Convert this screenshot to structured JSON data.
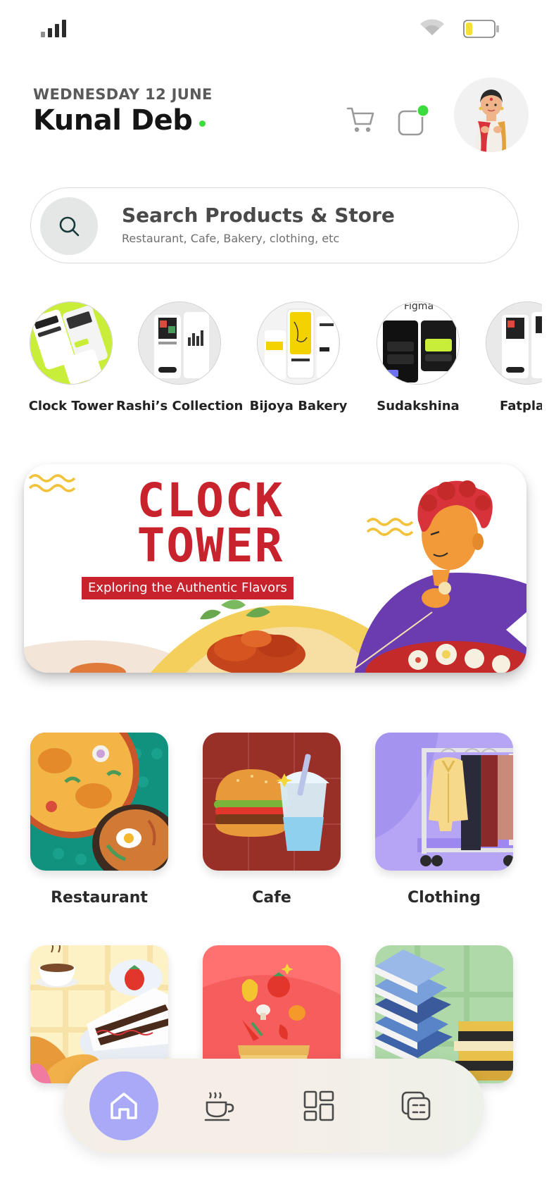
{
  "header": {
    "date": "WEDNESDAY 12 JUNE",
    "username": "Kunal Deb"
  },
  "icons": {
    "signal": "signal-bars-icon",
    "wifi": "wifi-icon",
    "battery": "battery-icon",
    "cart": "cart-icon",
    "notification": "notification-icon",
    "search": "search-icon",
    "home": "home-icon",
    "cafe": "coffee-cup-icon",
    "dashboard": "dashboard-grid-icon",
    "orders": "orders-icon"
  },
  "status": {
    "battery_level": 0.2,
    "online": true,
    "has_notification": true
  },
  "search": {
    "title": "Search Products & Store",
    "subtitle": "Restaurant, Cafe, Bakery, clothing, etc"
  },
  "stores": [
    {
      "name": "Clock Tower"
    },
    {
      "name": "Rashi’s Collection"
    },
    {
      "name": "Bijoya Bakery"
    },
    {
      "name": "Sudakshina"
    },
    {
      "name": "Fatpla"
    }
  ],
  "banner": {
    "title_line1": "CLOCK",
    "title_line2": "TOWER",
    "tagline": "Exploring the Authentic Flavors"
  },
  "categories": [
    {
      "label": "Restaurant"
    },
    {
      "label": "Cafe"
    },
    {
      "label": "Clothing"
    },
    {
      "label": ""
    },
    {
      "label": ""
    },
    {
      "label": ""
    }
  ],
  "nav": {
    "active": "home"
  },
  "colors": {
    "accent": "#a9a9f7",
    "online_dot": "#3ddc3d",
    "banner_red": "#c8222c",
    "battery_fill": "#f5e134"
  }
}
